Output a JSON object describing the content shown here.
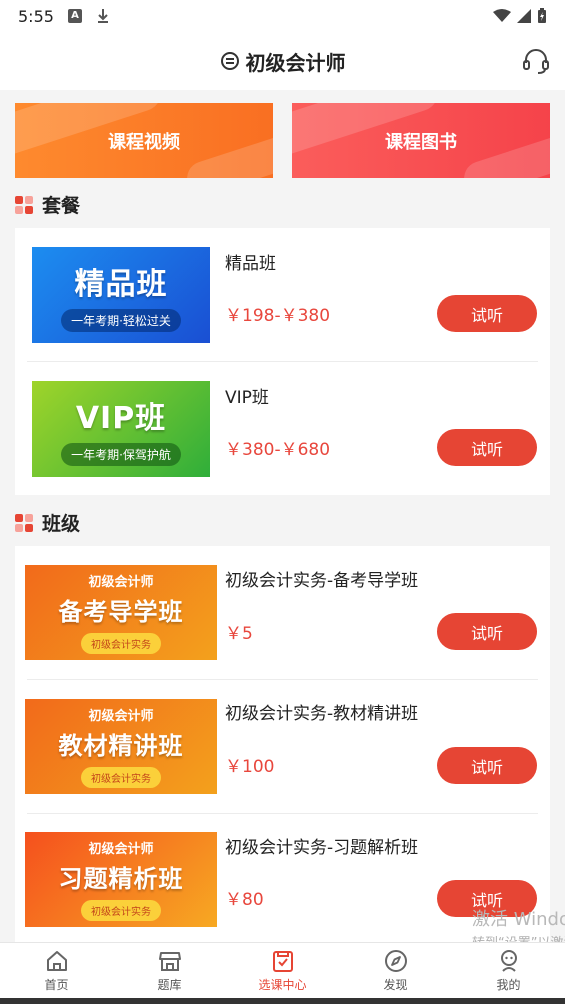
{
  "status_bar": {
    "time": "5:55"
  },
  "header": {
    "title": "初级会计师"
  },
  "top_buttons": {
    "video": "课程视频",
    "books": "课程图书"
  },
  "colors": {
    "accent": "#e64534",
    "price": "#e8473d"
  },
  "packages": {
    "section_title": "套餐",
    "items": [
      {
        "title": "精品班",
        "price": "￥198-￥380",
        "thumb_text": "精品班",
        "thumb_tag": "一年考期·轻松过关",
        "button": "试听"
      },
      {
        "title": "VIP班",
        "price": "￥380-￥680",
        "thumb_text": "VIP班",
        "thumb_tag": "一年考期·保驾护航",
        "button": "试听"
      }
    ]
  },
  "classes": {
    "section_title": "班级",
    "items": [
      {
        "title": "初级会计实务-备考导学班",
        "price": "￥5",
        "thumb_top": "初级会计师",
        "thumb_text": "备考导学班",
        "thumb_tag": "初级会计实务",
        "button": "试听"
      },
      {
        "title": "初级会计实务-教材精讲班",
        "price": "￥100",
        "thumb_top": "初级会计师",
        "thumb_text": "教材精讲班",
        "thumb_tag": "初级会计实务",
        "button": "试听"
      },
      {
        "title": "初级会计实务-习题解析班",
        "price": "￥80",
        "thumb_top": "初级会计师",
        "thumb_text": "习题精析班",
        "thumb_tag": "初级会计实务",
        "button": "试听"
      }
    ]
  },
  "watermark": {
    "line1": "激活 Windows",
    "line2": "转到“设置”以激活 Windows。"
  },
  "tabbar": [
    {
      "label": "首页",
      "icon": "home-icon"
    },
    {
      "label": "题库",
      "icon": "store-icon"
    },
    {
      "label": "选课中心",
      "icon": "course-icon",
      "active": true
    },
    {
      "label": "发现",
      "icon": "compass-icon"
    },
    {
      "label": "我的",
      "icon": "user-icon"
    }
  ]
}
